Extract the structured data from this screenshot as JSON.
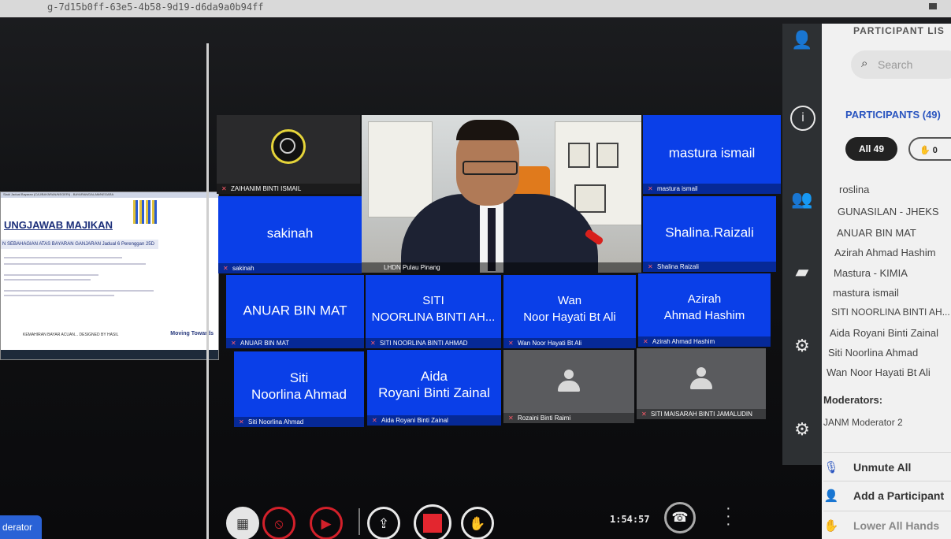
{
  "browser": {
    "url_fragment": "g-7d15b0ff-63e5-4b58-9d19-d6da9a0b94ff"
  },
  "shared_screen": {
    "header_small": "Slaid Jadual Bayaran (CAJ/BAYARAN/NEGERI) - BAYARAN/DALAM/NEGARA",
    "title": "UNGJAWAB MAJIKAN",
    "subtitle": "N SEBAHAGIAN ATAS BAYARAN GANJARAN Jadual 6 Perenggan 25D",
    "footer": "KEMAHIRAN BAYAR ACUAN... DESIGNED BY HASIL",
    "brand": "Moving Towards"
  },
  "tiles": [
    {
      "name": "",
      "caption": "ZAIHANIM BINTI ISMAIL",
      "style": "dark"
    },
    {
      "name": "mastura ismail",
      "caption": "mastura ismail",
      "style": "blue"
    },
    {
      "name": "sakinah",
      "caption": "sakinah",
      "style": "blue"
    },
    {
      "name": "Shalina.Raizali",
      "caption": "Shalina Raizali",
      "style": "blue"
    },
    {
      "name": "ANUAR BIN MAT",
      "caption": "ANUAR BIN MAT",
      "style": "blue"
    },
    {
      "name": "SITI\nNOORLINA BINTI AH...",
      "caption": "SITI NOORLINA BINTI AHMAD",
      "style": "blue"
    },
    {
      "name": "Wan\nNoor Hayati Bt Ali",
      "caption": "Wan Noor Hayati Bt Ali",
      "style": "blue"
    },
    {
      "name": "Azirah\nAhmad Hashim",
      "caption": "Azirah Ahmad Hashim",
      "style": "blue"
    },
    {
      "name": "Siti\nNoorlina Ahmad",
      "caption": "Siti Noorlina Ahmad",
      "style": "blue"
    },
    {
      "name": "Aida\nRoyani Binti Zainal",
      "caption": "Aida Royani Binti Zainal",
      "style": "blue"
    },
    {
      "name": "",
      "caption": "Rozaini Binti Raimi",
      "style": "gray"
    },
    {
      "name": "",
      "caption": "SITI MAISARAH BINTI JAMALUDIN",
      "style": "gray"
    }
  ],
  "main_video": {
    "caption": "LHDN Pulau Pinang"
  },
  "panel": {
    "header": "PARTICIPANT LIS",
    "search_placeholder": "Search",
    "count_label": "PARTICIPANTS (49)",
    "filter_all": "All  49",
    "filter_hands": "0",
    "participants": [
      "roslina",
      "GUNASILAN - JHEKS",
      "ANUAR BIN MAT",
      "Azirah Ahmad Hashim",
      "Mastura - KIMIA",
      "mastura ismail",
      "SITI NOORLINA BINTI AH...",
      "Aida Royani Binti Zainal",
      "Siti Noorlina Ahmad",
      "Wan Noor Hayati Bt Ali"
    ],
    "moderators_label": "Moderators:",
    "moderators": [
      "JANM Moderator 2"
    ],
    "actions": [
      "Unmute All",
      "Add a Participant",
      "Lower All Hands"
    ]
  },
  "controls": {
    "timer": "1:54:57",
    "moderator_tag": "derator"
  },
  "colors": {
    "tile_blue": "#0a3fe8",
    "accent": "#2a55c0",
    "end_call": "#d3202a"
  }
}
